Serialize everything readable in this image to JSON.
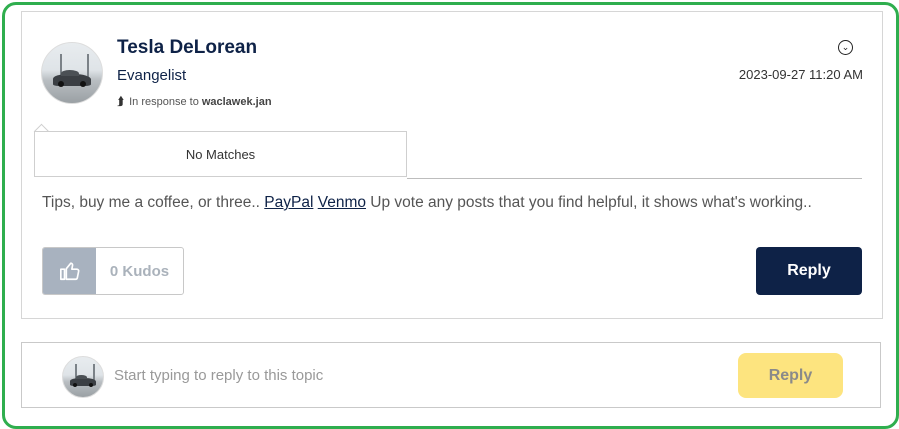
{
  "post": {
    "author": "Tesla DeLorean",
    "rank": "Evangelist",
    "in_response_prefix": "In response to",
    "in_response_user": "waclawek.jan",
    "timestamp": "2023-09-27 11:20 AM",
    "popup_text": "No Matches",
    "signature": {
      "before": "Tips, buy me a coffee, or three.. ",
      "link1": "PayPal",
      "between": " ",
      "link2": "Venmo",
      "after": " Up vote any posts that you find helpful, it shows what's working.."
    },
    "kudos_label": "0 Kudos",
    "reply_label": "Reply"
  },
  "reply_bar": {
    "placeholder": "Start typing to reply to this topic",
    "reply_label": "Reply"
  },
  "colors": {
    "outline": "#2fae4e",
    "navy": "#0e2247",
    "kudos_thumb": "#a8b2bf",
    "reply_yellow": "#fde47f"
  }
}
